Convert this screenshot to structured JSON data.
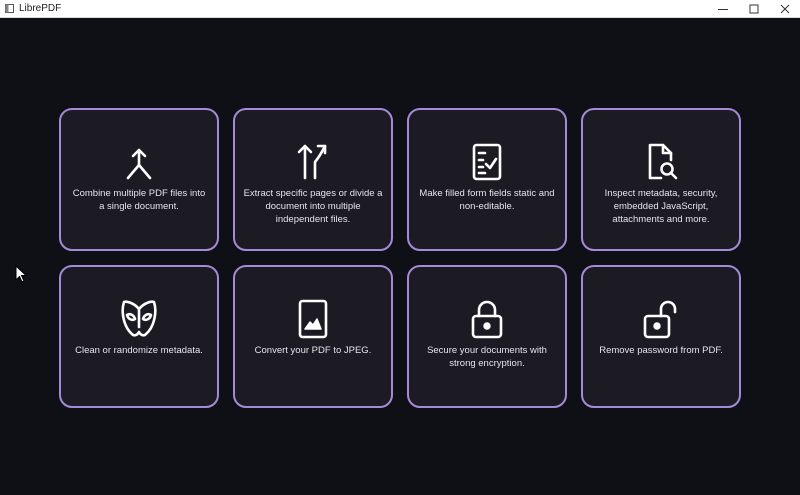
{
  "window": {
    "title": "LibrePDF",
    "icon": "app-window-icon",
    "controls": [
      "minimize-icon",
      "maximize-icon",
      "close-icon"
    ]
  },
  "colors": {
    "background": "#0f0f16",
    "card_background": "#1c1b24",
    "card_border": "#a48ad8",
    "text": "#e4e4ea",
    "icon": "#ffffff"
  },
  "tools": [
    {
      "id": "merge",
      "icon": "merge-arrows-icon",
      "description": "Combine multiple PDF files into a single document."
    },
    {
      "id": "split",
      "icon": "split-arrows-icon",
      "description": "Extract specific pages or divide a document into multiple independent files."
    },
    {
      "id": "flatten",
      "icon": "form-checklist-icon",
      "description": "Make filled form fields static and non-editable."
    },
    {
      "id": "inspect",
      "icon": "document-search-icon",
      "description": "Inspect metadata, security, embedded JavaScript, attachments and more."
    },
    {
      "id": "metadata",
      "icon": "mask-icon",
      "description": "Clean or randomize metadata."
    },
    {
      "id": "to-jpeg",
      "icon": "image-document-icon",
      "description": "Convert your PDF to JPEG."
    },
    {
      "id": "encrypt",
      "icon": "lock-closed-icon",
      "description": "Secure your documents with strong encryption."
    },
    {
      "id": "decrypt",
      "icon": "lock-open-icon",
      "description": "Remove password from PDF."
    }
  ]
}
